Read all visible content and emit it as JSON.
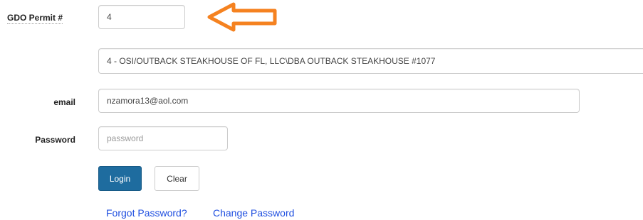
{
  "form": {
    "permit_label": "GDO Permit #",
    "permit_value": "4",
    "establishment_value": "4 - OSI/OUTBACK STEAKHOUSE OF FL, LLC\\DBA OUTBACK STEAKHOUSE #1077",
    "email_label": "email",
    "email_value": "nzamora13@aol.com",
    "password_label": "Password",
    "password_placeholder": "password"
  },
  "buttons": {
    "login_label": "Login",
    "clear_label": "Clear"
  },
  "links": {
    "forgot_password": "Forgot Password?",
    "change_password": "Change Password"
  },
  "annotation": {
    "arrow_icon": "left-arrow-icon",
    "arrow_color": "#f58220"
  },
  "colors": {
    "login_button_bg": "#1e6c9f",
    "link_color": "#1f4fe0"
  }
}
